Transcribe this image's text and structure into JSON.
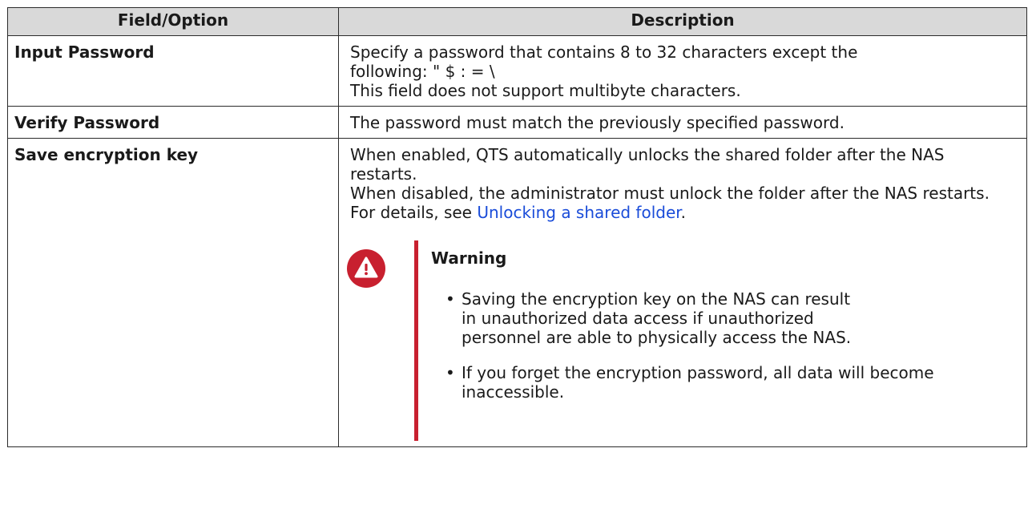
{
  "table": {
    "headers": [
      "Field/Option",
      "Description"
    ],
    "rows": [
      {
        "field": "Input Password",
        "desc_lines": [
          "Specify a password that contains 8 to 32 characters except the following: \" $ : = \\",
          "This field does not support multibyte characters."
        ]
      },
      {
        "field": "Verify Password",
        "desc_lines": [
          "The password must match the previously specified password."
        ]
      },
      {
        "field": "Save encryption key",
        "desc_lines": [
          "When enabled, QTS automatically unlocks the shared folder after the NAS restarts.",
          "When disabled, the administrator must unlock the folder after the NAS restarts."
        ],
        "details_prefix": "For details, see ",
        "details_link": "Unlocking a shared folder",
        "details_suffix": ".",
        "note": {
          "title": "Warning",
          "icon": "warning-icon",
          "color": "#c8202f",
          "items": [
            "Saving the encryption key on the NAS can result in unauthorized data access if unauthorized personnel are able to physically access the NAS.",
            "If you forget the encryption password, all data will become inaccessible."
          ]
        }
      }
    ]
  }
}
